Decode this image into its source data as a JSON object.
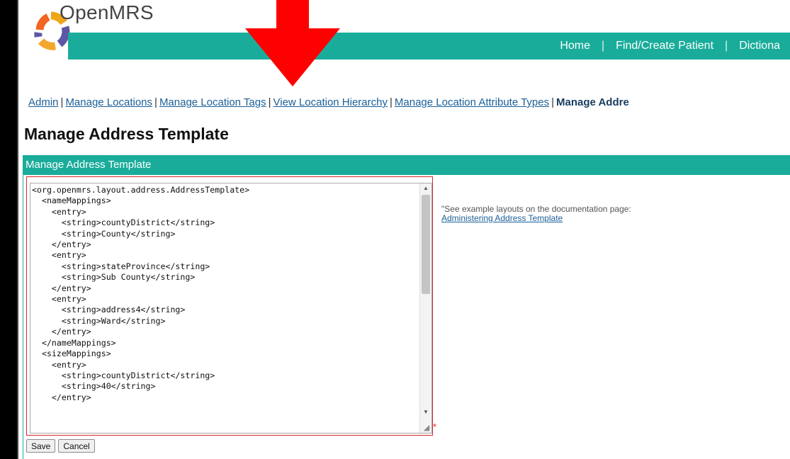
{
  "app": {
    "brand": "OpenMRS",
    "colors": {
      "accent": "#1aac9b",
      "link": "#1b5f97",
      "highlight": "#d9262e",
      "arrow": "#ff0000"
    }
  },
  "topnav": {
    "items": [
      "Home",
      "Find/Create Patient",
      "Dictiona"
    ],
    "separator": "|"
  },
  "breadcrumb": {
    "items": [
      "Admin",
      "Manage Locations",
      "Manage Location Tags",
      "View Location Hierarchy",
      "Manage Location Attribute Types"
    ],
    "current": "Manage Addre"
  },
  "page": {
    "title": "Manage Address Template"
  },
  "panel": {
    "title": "Manage Address Template",
    "template_value": "<org.openmrs.layout.address.AddressTemplate>\n  <nameMappings>\n    <entry>\n      <string>countyDistrict</string>\n      <string>County</string>\n    </entry>\n    <entry>\n      <string>stateProvince</string>\n      <string>Sub County</string>\n    </entry>\n    <entry>\n      <string>address4</string>\n      <string>Ward</string>\n    </entry>\n  </nameMappings>\n  <sizeMappings>\n    <entry>\n      <string>countyDistrict</string>\n      <string>40</string>\n    </entry>",
    "required_marker": "*",
    "note_text": "\"See example layouts on the documentation page: ",
    "note_link": "Administering Address Template"
  },
  "buttons": {
    "save": "Save",
    "cancel": "Cancel"
  },
  "icons": {
    "logo": "openmrs-logo-icon",
    "scroll_up": "▲",
    "scroll_down": "▼",
    "resize": "◢"
  }
}
